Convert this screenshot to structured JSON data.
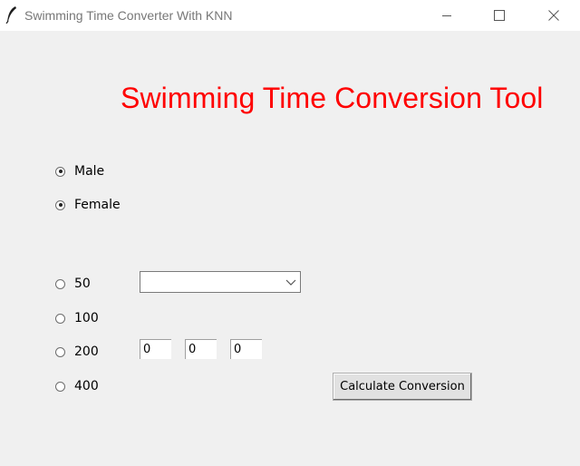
{
  "window": {
    "title": "Swimming Time Converter With KNN",
    "icon": "feather-icon"
  },
  "main": {
    "heading": "Swimming Time Conversion Tool",
    "gender_options": [
      {
        "label": "Male",
        "checked": true
      },
      {
        "label": "Female",
        "checked": true
      }
    ],
    "distance_options": [
      {
        "label": "50",
        "checked": false
      },
      {
        "label": "100",
        "checked": false
      },
      {
        "label": "200",
        "checked": false
      },
      {
        "label": "400",
        "checked": false
      }
    ],
    "stroke_select": {
      "value": ""
    },
    "time_inputs": [
      "0",
      "0",
      "0"
    ],
    "calculate_button_label": "Calculate Conversion"
  },
  "colors": {
    "heading": "#ff0000",
    "background": "#f0f0f0"
  }
}
